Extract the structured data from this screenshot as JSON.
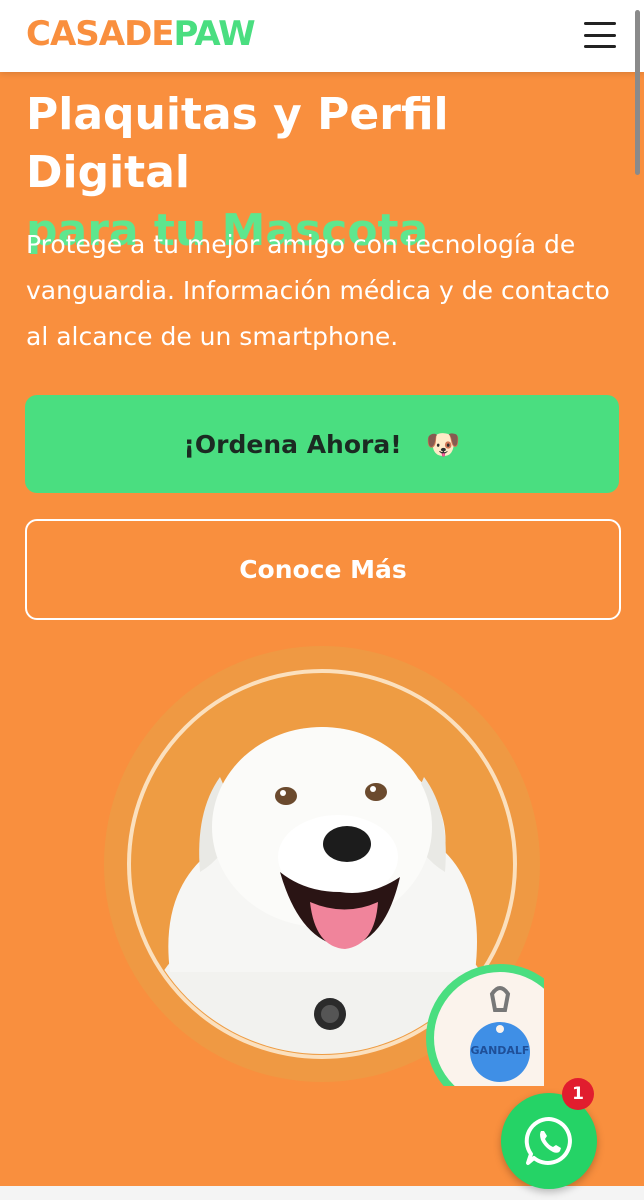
{
  "header": {
    "logo_part1": "CASADE",
    "logo_part2": "PAW",
    "menu_icon": "hamburger-menu-icon"
  },
  "hero": {
    "title_line1": "Plaquitas y Perfil Digital",
    "title_line2": "para tu Mascota",
    "description": "Protege a tu mejor amigo con tecnología de vanguardia. Información médica y de contacto al alcance de un smartphone.",
    "order_button_label": "¡Ordena Ahora!",
    "order_button_emoji": "🐶",
    "more_button_label": "Conoce Más",
    "tag_name": "GANDALF"
  },
  "whatsapp": {
    "icon": "whatsapp-icon",
    "badge_count": "1"
  },
  "colors": {
    "background": "#F98F3E",
    "accent_green": "#4ADE80",
    "title_accent": "#5EE68E",
    "whatsapp_green": "#25D366",
    "badge_red": "#E11D2E",
    "tag_blue": "#3F8FE6"
  }
}
